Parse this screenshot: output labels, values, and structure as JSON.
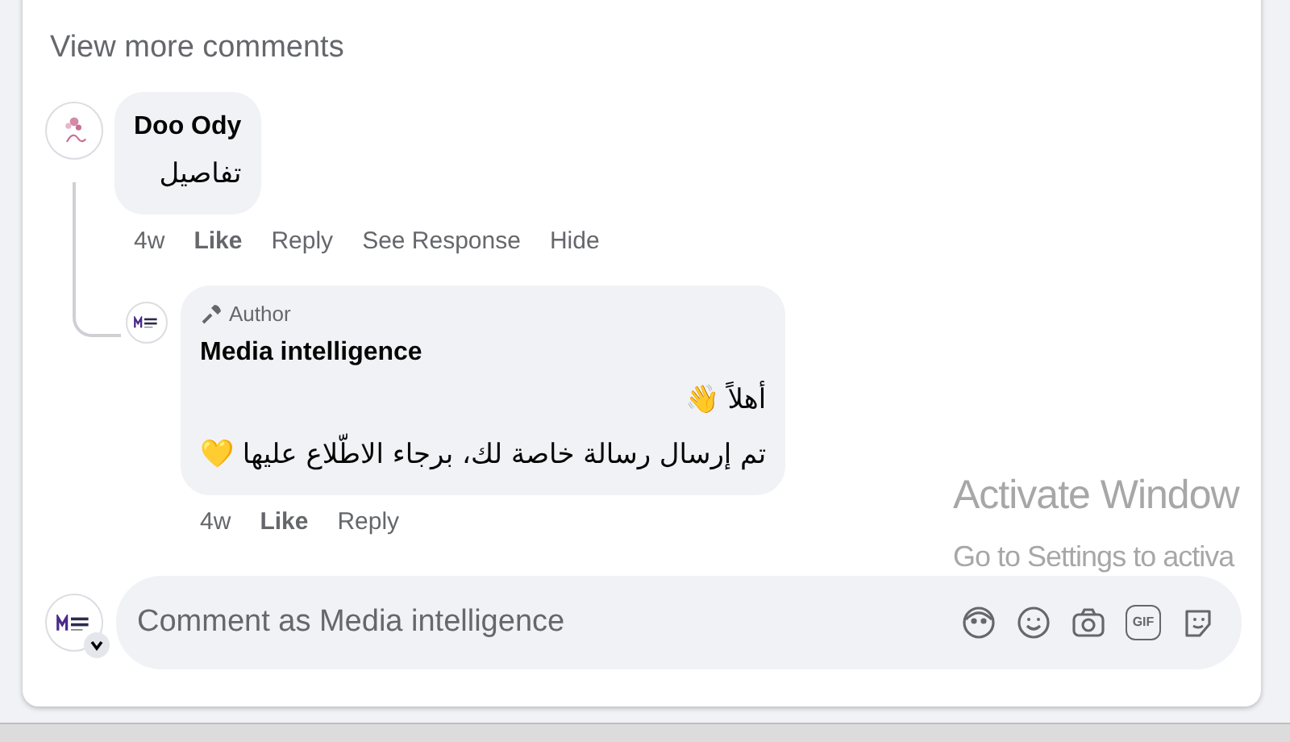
{
  "view_more": "View more comments",
  "comments": [
    {
      "author": "Doo Ody",
      "lines": [
        "تفاصيل"
      ],
      "actions": [
        "4w",
        "Like",
        "Reply",
        "See Response",
        "Hide"
      ],
      "replies": [
        {
          "author": "Media intelligence",
          "badge": "Author",
          "lines": [
            "أهلاً 👋",
            "تم إرسال رسالة خاصة لك، برجاء الاطّلاع عليها 💛"
          ],
          "actions": [
            "4w",
            "Like",
            "Reply"
          ]
        }
      ]
    }
  ],
  "composer": {
    "placeholder": "Comment as Media intelligence",
    "gif_label": "GIF"
  },
  "os_overlay": {
    "title": "Activate Window",
    "subtitle": "Go to Settings to activa"
  }
}
